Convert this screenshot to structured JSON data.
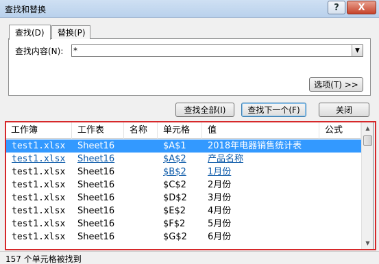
{
  "window": {
    "title": "查找和替换",
    "help_label": "?",
    "close_label": "X"
  },
  "tabs": [
    {
      "label": "查找(D)"
    },
    {
      "label": "替换(P)"
    }
  ],
  "find": {
    "label": "查找内容(N):",
    "value": "*",
    "dropdown_arrow": "▼"
  },
  "buttons": {
    "options": "选项(T) >>",
    "find_all": "查找全部(I)",
    "find_next": "查找下一个(F)",
    "close": "关闭"
  },
  "results": {
    "columns": [
      "工作簿",
      "工作表",
      "名称",
      "单元格",
      "值",
      "公式"
    ],
    "rows": [
      {
        "workbook": "test1.xlsx",
        "sheet": "Sheet16",
        "name": "",
        "cell": "$A$1",
        "value": "2018年电器销售统计表",
        "state": "selected"
      },
      {
        "workbook": "test1.xlsx",
        "sheet": "Sheet16",
        "name": "",
        "cell": "$A$2",
        "value": "产品名称",
        "state": "visited"
      },
      {
        "workbook": "test1.xlsx",
        "sheet": "Sheet16",
        "name": "",
        "cell": "$B$2",
        "value": "1月份",
        "state": "visited-partial"
      },
      {
        "workbook": "test1.xlsx",
        "sheet": "Sheet16",
        "name": "",
        "cell": "$C$2",
        "value": "2月份",
        "state": "normal"
      },
      {
        "workbook": "test1.xlsx",
        "sheet": "Sheet16",
        "name": "",
        "cell": "$D$2",
        "value": "3月份",
        "state": "normal"
      },
      {
        "workbook": "test1.xlsx",
        "sheet": "Sheet16",
        "name": "",
        "cell": "$E$2",
        "value": "4月份",
        "state": "normal"
      },
      {
        "workbook": "test1.xlsx",
        "sheet": "Sheet16",
        "name": "",
        "cell": "$F$2",
        "value": "5月份",
        "state": "normal"
      },
      {
        "workbook": "test1.xlsx",
        "sheet": "Sheet16",
        "name": "",
        "cell": "$G$2",
        "value": "6月份",
        "state": "normal"
      }
    ]
  },
  "scrollbar": {
    "up_arrow": "▲",
    "down_arrow": "▼"
  },
  "status": {
    "text": "157 个单元格被找到"
  },
  "colors": {
    "selection": "#3399ff",
    "highlight_border": "#d6282a",
    "link": "#0b59a8"
  }
}
